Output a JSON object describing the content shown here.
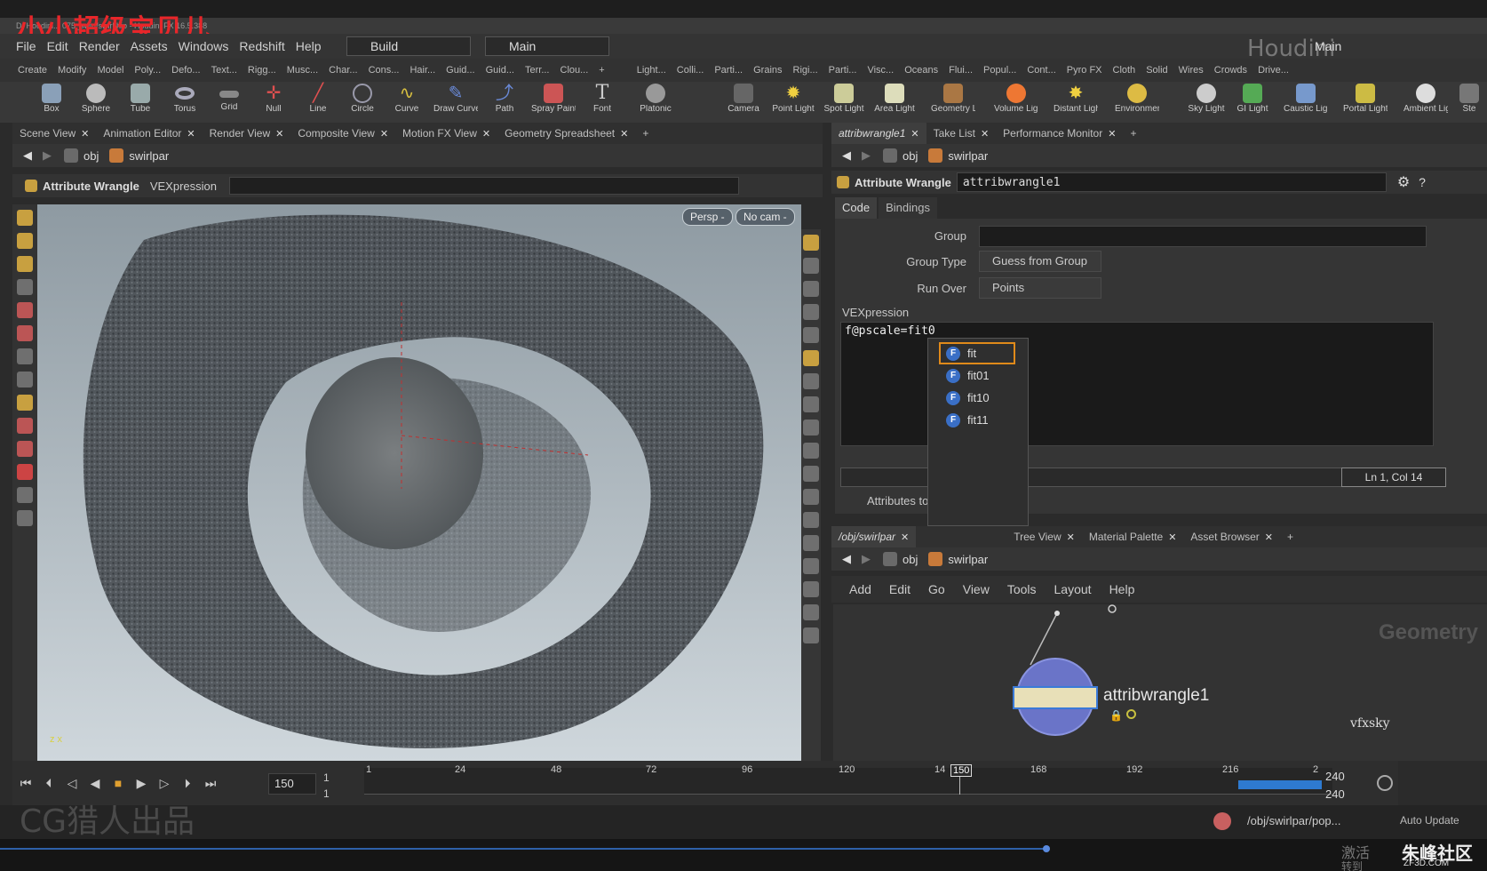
{
  "window": {
    "title": "D: Houdini... 075_swirl/swirl.hip - Houdini FX 16.5.388"
  },
  "watermarks": {
    "top_left": "小小超级宝贝儿",
    "bottom_left": "CG猎人出品",
    "network": "vfxsky",
    "logo_left": "激活",
    "logo_right": "朱峰社区",
    "logo_url": "ZF3D.COM",
    "corner": "转到"
  },
  "menubar": {
    "items": [
      "File",
      "Edit",
      "Render",
      "Assets",
      "Windows",
      "Redshift",
      "Help"
    ],
    "desktop": "Build",
    "layout": "Main",
    "right_layout": "Main"
  },
  "shelf_left": {
    "tabs": [
      "Create",
      "Modify",
      "Model",
      "Poly...",
      "Defo...",
      "Text...",
      "Rigg...",
      "Musc...",
      "Char...",
      "Cons...",
      "Hair...",
      "Guid...",
      "Guid...",
      "Terr...",
      "Clou..."
    ],
    "tools": [
      "Box",
      "Sphere",
      "Tube",
      "Torus",
      "Grid",
      "Null",
      "Line",
      "Circle",
      "Curve",
      "Draw Curve",
      "Path",
      "Spray Paint",
      "Font",
      "Platonic"
    ]
  },
  "shelf_right": {
    "tabs": [
      "Light...",
      "Colli...",
      "Parti...",
      "Grains",
      "Rigi...",
      "Parti...",
      "Visc...",
      "Oceans",
      "Flui...",
      "Popul...",
      "Cont...",
      "Pyro FX",
      "Cloth",
      "Solid",
      "Wires",
      "Crowds",
      "Drive..."
    ],
    "tools": [
      "Camera",
      "Point Light",
      "Spot Light",
      "Area Light",
      "Geometry Light",
      "Volume Light",
      "Distant Light",
      "Environment Light",
      "Sky Light",
      "GI Light",
      "Caustic Light",
      "Portal Light",
      "Ambient Light",
      "Ste"
    ]
  },
  "left_pane": {
    "tabs": [
      "Scene View",
      "Animation Editor",
      "Render View",
      "Composite View",
      "Motion FX View",
      "Geometry Spreadsheet"
    ],
    "path": {
      "root": "obj",
      "node": "swirlpar"
    },
    "op_bar": {
      "name": "Attribute Wrangle",
      "param": "VEXpression"
    },
    "viewport": {
      "persp": "Persp -",
      "cam": "No cam -",
      "axis": "z x"
    }
  },
  "right_pane": {
    "tabs": [
      "attribwrangle1",
      "Take List",
      "Performance Monitor"
    ],
    "path": {
      "root": "obj",
      "node": "swirlpar"
    },
    "node_type": "Attribute Wrangle",
    "node_name": "attribwrangle1",
    "param_tabs": [
      "Code",
      "Bindings"
    ],
    "group_label": "Group",
    "group_type_label": "Group Type",
    "group_type_value": "Guess from Group",
    "run_over_label": "Run Over",
    "run_over_value": "Points",
    "vex_label": "VEXpression",
    "code": "f@pscale=fit0",
    "cursor_pos": "Ln 1, Col 14",
    "attributes_label": "Attributes to",
    "autocomplete": [
      "fit",
      "fit01",
      "fit10",
      "fit11"
    ]
  },
  "network_pane": {
    "tabs": [
      "/obj/swirlpar",
      "Tree View",
      "Material Palette",
      "Asset Browser"
    ],
    "path": {
      "root": "obj",
      "node": "swirlpar"
    },
    "menu": [
      "Add",
      "Edit",
      "Go",
      "View",
      "Tools",
      "Layout",
      "Help"
    ],
    "context": "Geometry",
    "node_label": "attribwrangle1"
  },
  "timeline": {
    "frame": "150",
    "start": "1",
    "start2": "1",
    "end": "240",
    "end2": "240",
    "ticks": [
      "1",
      "24",
      "48",
      "72",
      "96",
      "120",
      "14",
      "150",
      "168",
      "192",
      "216",
      "2"
    ]
  },
  "status": {
    "path": "/obj/swirlpar/pop...",
    "auto_update": "Auto Update"
  }
}
